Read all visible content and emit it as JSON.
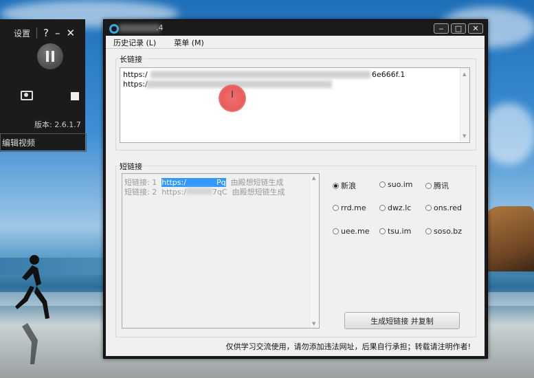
{
  "recorder": {
    "settings_label": "设置",
    "help_glyph": "?",
    "minimize_glyph": "–",
    "close_glyph": "✕",
    "version": "版本: 2.6.1.7",
    "edit_video": "编辑视频"
  },
  "window": {
    "title_suffix": ".4",
    "menus": [
      {
        "label": "历史记录 (L)"
      },
      {
        "label": "菜单 (M)"
      }
    ],
    "controls": {
      "min": "‒",
      "max": "□",
      "close": "✕"
    }
  },
  "long_link": {
    "group_label": "长链接",
    "lines": [
      "https:/",
      "https:/"
    ],
    "line1_tail": "6e666f.1"
  },
  "short_link": {
    "group_label": "短链接",
    "rows": [
      {
        "prefix": "短链接: 1",
        "url_start": "https:/",
        "url_end": "Pq",
        "note": "由殿想短链生成",
        "selected": true
      },
      {
        "prefix": "短链接: 2",
        "url_start": "https:/",
        "url_end": "7qC",
        "note": "由殿想短链生成",
        "selected": false
      }
    ]
  },
  "services": [
    {
      "label": "新浪",
      "checked": true
    },
    {
      "label": "suo.im",
      "checked": false
    },
    {
      "label": "腾讯",
      "checked": false
    },
    {
      "label": "rrd.me",
      "checked": false
    },
    {
      "label": "dwz.lc",
      "checked": false
    },
    {
      "label": "ons.red",
      "checked": false
    },
    {
      "label": "uee.me",
      "checked": false
    },
    {
      "label": "tsu.im",
      "checked": false
    },
    {
      "label": "soso.bz",
      "checked": false
    }
  ],
  "generate_button": "生成短链接 并复制",
  "footer": "仅供学习交流使用，请勿添加违法网址，后果自行承担；转载请注明作者!"
}
